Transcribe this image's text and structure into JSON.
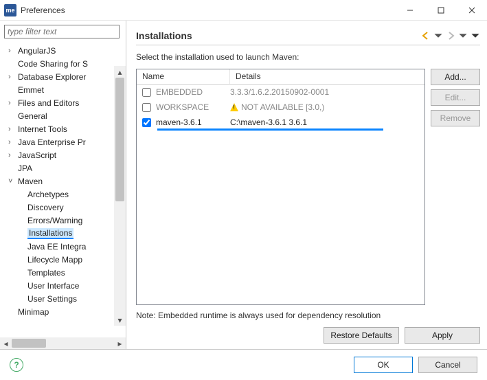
{
  "window": {
    "title": "Preferences"
  },
  "filter": {
    "placeholder": "type filter text"
  },
  "tree": {
    "items": [
      {
        "label": "AngularJS",
        "expandable": true,
        "expanded": false,
        "level": 0
      },
      {
        "label": "Code Sharing for S",
        "expandable": false,
        "level": 0
      },
      {
        "label": "Database Explorer",
        "expandable": true,
        "expanded": false,
        "level": 0
      },
      {
        "label": "Emmet",
        "expandable": false,
        "level": 0
      },
      {
        "label": "Files and Editors",
        "expandable": true,
        "expanded": false,
        "level": 0
      },
      {
        "label": "General",
        "expandable": false,
        "level": 0
      },
      {
        "label": "Internet Tools",
        "expandable": true,
        "expanded": false,
        "level": 0
      },
      {
        "label": "Java Enterprise Pr",
        "expandable": true,
        "expanded": false,
        "level": 0
      },
      {
        "label": "JavaScript",
        "expandable": true,
        "expanded": false,
        "level": 0
      },
      {
        "label": "JPA",
        "expandable": false,
        "level": 0
      },
      {
        "label": "Maven",
        "expandable": true,
        "expanded": true,
        "level": 0
      },
      {
        "label": "Archetypes",
        "expandable": false,
        "level": 1
      },
      {
        "label": "Discovery",
        "expandable": false,
        "level": 1
      },
      {
        "label": "Errors/Warning",
        "expandable": false,
        "level": 1
      },
      {
        "label": "Installations",
        "expandable": false,
        "level": 1,
        "selected": true
      },
      {
        "label": "Java EE Integra",
        "expandable": false,
        "level": 1
      },
      {
        "label": "Lifecycle Mapp",
        "expandable": false,
        "level": 1
      },
      {
        "label": "Templates",
        "expandable": false,
        "level": 1
      },
      {
        "label": "User Interface",
        "expandable": false,
        "level": 1
      },
      {
        "label": "User Settings",
        "expandable": false,
        "level": 1
      },
      {
        "label": "Minimap",
        "expandable": false,
        "level": 0
      }
    ]
  },
  "page": {
    "title": "Installations",
    "description": "Select the installation used to launch Maven:",
    "columns": {
      "name": "Name",
      "details": "Details"
    },
    "rows": [
      {
        "checked": false,
        "name": "EMBEDDED",
        "details": "3.3.3/1.6.2.20150902-0001",
        "warn": false
      },
      {
        "checked": false,
        "name": "WORKSPACE",
        "details": "NOT AVAILABLE [3.0,)",
        "warn": true
      },
      {
        "checked": true,
        "name": "maven-3.6.1",
        "details": "C:\\maven-3.6.1 3.6.1",
        "warn": false
      }
    ],
    "buttons": {
      "add": "Add...",
      "edit": "Edit...",
      "remove": "Remove"
    },
    "note": "Note: Embedded runtime is always used for dependency resolution",
    "restore": "Restore Defaults",
    "apply": "Apply"
  },
  "footer": {
    "ok": "OK",
    "cancel": "Cancel"
  }
}
